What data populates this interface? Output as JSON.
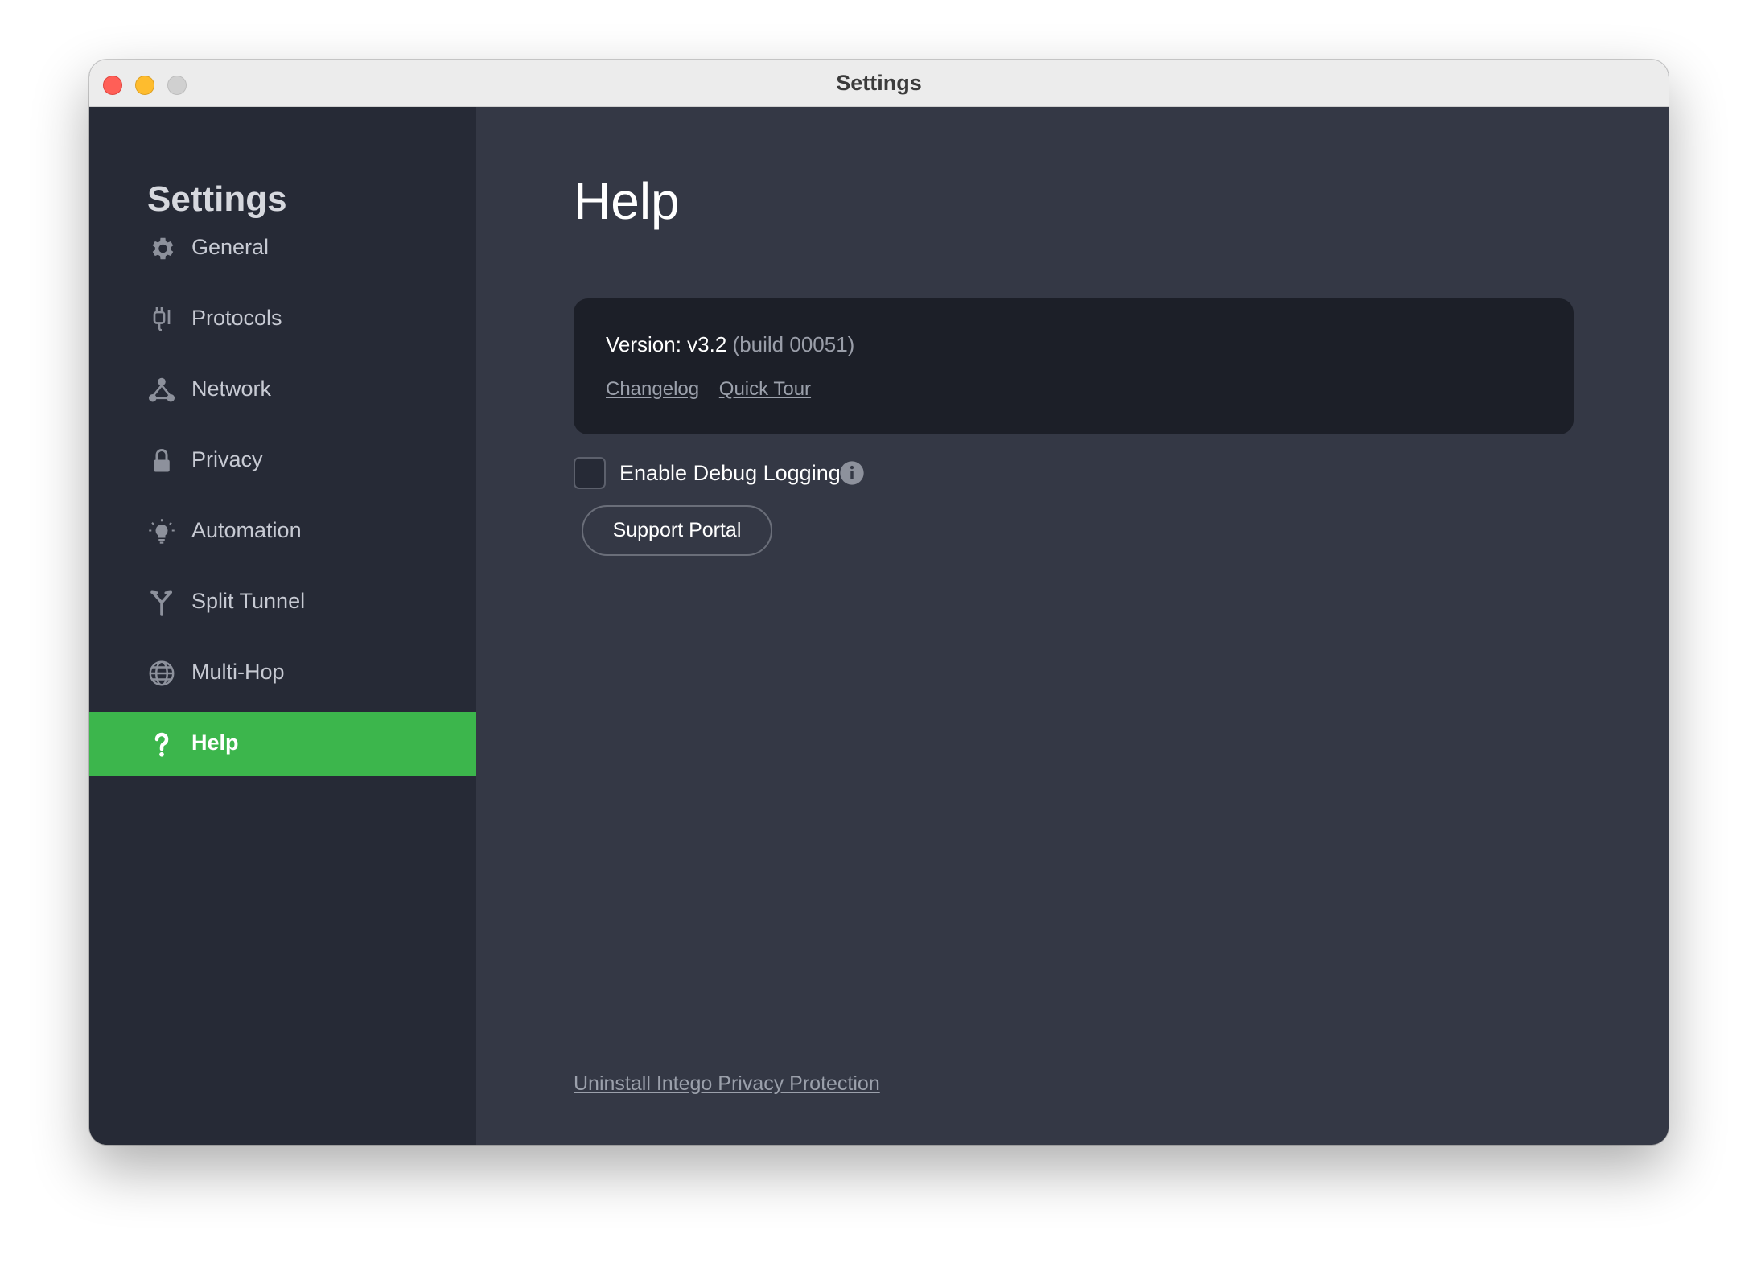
{
  "window": {
    "title": "Settings"
  },
  "sidebar": {
    "title": "Settings",
    "items": [
      {
        "label": "General",
        "icon": "gear-icon"
      },
      {
        "label": "Protocols",
        "icon": "plug-icon"
      },
      {
        "label": "Network",
        "icon": "network-icon"
      },
      {
        "label": "Privacy",
        "icon": "lock-icon"
      },
      {
        "label": "Automation",
        "icon": "lightbulb-icon"
      },
      {
        "label": "Split Tunnel",
        "icon": "split-tunnel-icon"
      },
      {
        "label": "Multi-Hop",
        "icon": "globe-icon"
      },
      {
        "label": "Help",
        "icon": "question-icon",
        "active": true
      }
    ]
  },
  "main": {
    "title": "Help",
    "version": {
      "label": "Version: v3.2",
      "build": "(build 00051)"
    },
    "links": {
      "changelog": "Changelog",
      "quick_tour": "Quick Tour"
    },
    "debug": {
      "label": "Enable Debug Logging",
      "checked": false
    },
    "support_button": "Support Portal",
    "uninstall_link": "Uninstall Intego Privacy Protection"
  },
  "colors": {
    "accent": "#3cb64c",
    "sidebar_bg": "#262a36",
    "main_bg": "#343845",
    "card_bg": "#1c1f28"
  }
}
